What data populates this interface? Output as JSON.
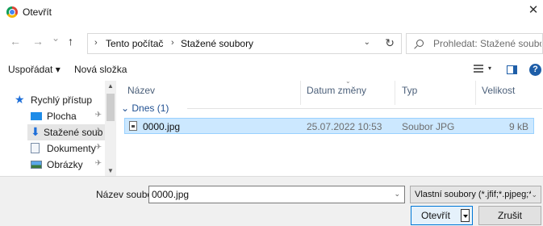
{
  "window": {
    "title": "Otevřít",
    "close_glyph": "✕"
  },
  "nav": {
    "back_glyph": "←",
    "forward_glyph": "→",
    "recent_glyph": "⌄",
    "up_glyph": "↑",
    "breadcrumb_sep": "›",
    "breadcrumb": [
      "Tento počítač",
      "Stažené soubory"
    ],
    "address_dropdown": "⌄",
    "refresh_glyph": "↻"
  },
  "search": {
    "placeholder": "Prohledat: Stažené soubory"
  },
  "toolbar": {
    "organize": "Uspořádat ▾",
    "new_folder": "Nová složka",
    "help": "?",
    "view_dropdown": "▾"
  },
  "sidebar": {
    "quick_access": "Rychlý přístup",
    "items": [
      {
        "label": "Plocha",
        "icon": "desktop-icon",
        "pinned": true
      },
      {
        "label": "Stažené soub",
        "icon": "download-icon",
        "pinned": true
      },
      {
        "label": "Dokumenty",
        "icon": "documents-icon",
        "pinned": true
      },
      {
        "label": "Obrázky",
        "icon": "pictures-icon",
        "pinned": true
      }
    ],
    "pin_glyph": "📌",
    "scroll_up": "▲",
    "scroll_down": "▼"
  },
  "filelist": {
    "columns": [
      "Název",
      "Datum změny",
      "Typ",
      "Velikost"
    ],
    "group": "Dnes (1)",
    "rows": [
      {
        "name": "0000.jpg",
        "modified": "25.07.2022 10:53",
        "type": "Soubor JPG",
        "size": "9 kB"
      }
    ]
  },
  "bottom": {
    "filename_label": "Název souboru:",
    "filename_value": "0000.jpg",
    "filename_dropdown": "⌄",
    "filetype_value": "Vlastní soubory (*.jfif;*.pjpeg;*.jpeg;*.pjp;*.jpg)",
    "filetype_dropdown": "⌄",
    "open_label": "Otevřít",
    "cancel_label": "Zrušit"
  }
}
